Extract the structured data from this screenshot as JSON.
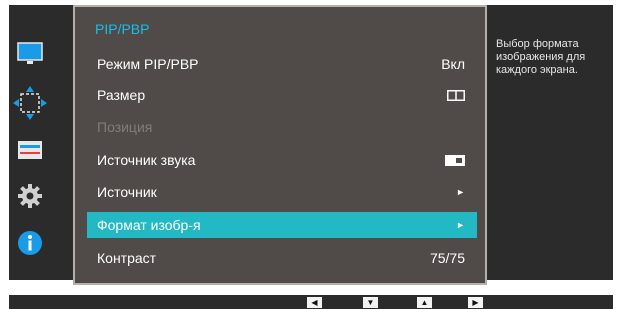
{
  "menu": {
    "title": "PIP/PBP",
    "items": [
      {
        "label": "Режим PIP/PBP",
        "value": "Вкл"
      },
      {
        "label": "Размер",
        "value": "",
        "icon": "pbp-split-icon"
      },
      {
        "label": "Позиция",
        "value": "",
        "disabled": true
      },
      {
        "label": "Источник звука",
        "value": "",
        "icon": "sound-source-icon"
      },
      {
        "label": "Источник",
        "value": "",
        "icon": "submenu-arrow-icon"
      },
      {
        "label": "Формат изобр-я",
        "value": "",
        "icon": "submenu-arrow-icon",
        "selected": true
      },
      {
        "label": "Контраст",
        "value": "75/75"
      }
    ]
  },
  "description": "Выбор формата изображения для каждого экрана.",
  "sidebar": {
    "icons": [
      "monitor-icon",
      "size-position-icon",
      "settings-bar-icon",
      "gear-icon",
      "info-icon"
    ],
    "active": "size-position-icon"
  },
  "nav_buttons": [
    "left-arrow-button",
    "down-arrow-button",
    "up-arrow-button",
    "right-arrow-button"
  ],
  "colors": {
    "accent": "#18bfe6",
    "selected": "#23b9c4",
    "panel": "#504a48",
    "background": "#2b2b2b"
  }
}
